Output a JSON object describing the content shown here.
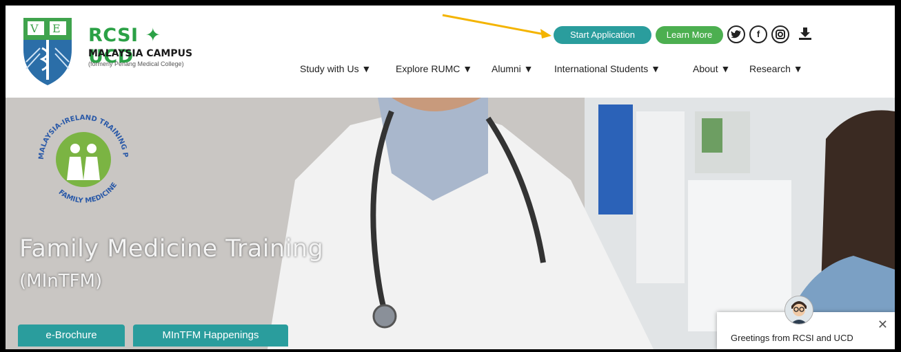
{
  "header": {
    "logo_line1": "RCSI ✦ UCD",
    "logo_line2": "MALAYSIA CAMPUS",
    "logo_line3": "(formerly Penang Medical College)",
    "start_application": "Start Application",
    "learn_more": "Learn More",
    "social": {
      "twitter": "🐦",
      "facebook": "f",
      "instagram": "◎",
      "download": "⭳"
    }
  },
  "nav": {
    "items": [
      {
        "label": "Study with Us ▼"
      },
      {
        "label": "Explore RUMC ▼"
      },
      {
        "label": "Alumni ▼"
      },
      {
        "label": "International Students ▼"
      },
      {
        "label": "About ▼"
      },
      {
        "label": "Research ▼"
      }
    ]
  },
  "hero": {
    "badge_top": "MALAYSIA-IRELAND TRAINING PROGRAMME FOR",
    "badge_bottom": "FAMILY MEDICINE",
    "title": "Family Medicine Training",
    "subtitle": "(MInTFM)",
    "button_brochure": "e-Brochure",
    "button_happenings": "MInTFM Happenings"
  },
  "chat": {
    "greeting": "Greetings from RCSI and UCD",
    "close": "✕"
  },
  "colors": {
    "brand_green": "#2ba146",
    "teal": "#2a9d9d",
    "learn_green": "#4caf50",
    "arrow": "#f4b400"
  }
}
